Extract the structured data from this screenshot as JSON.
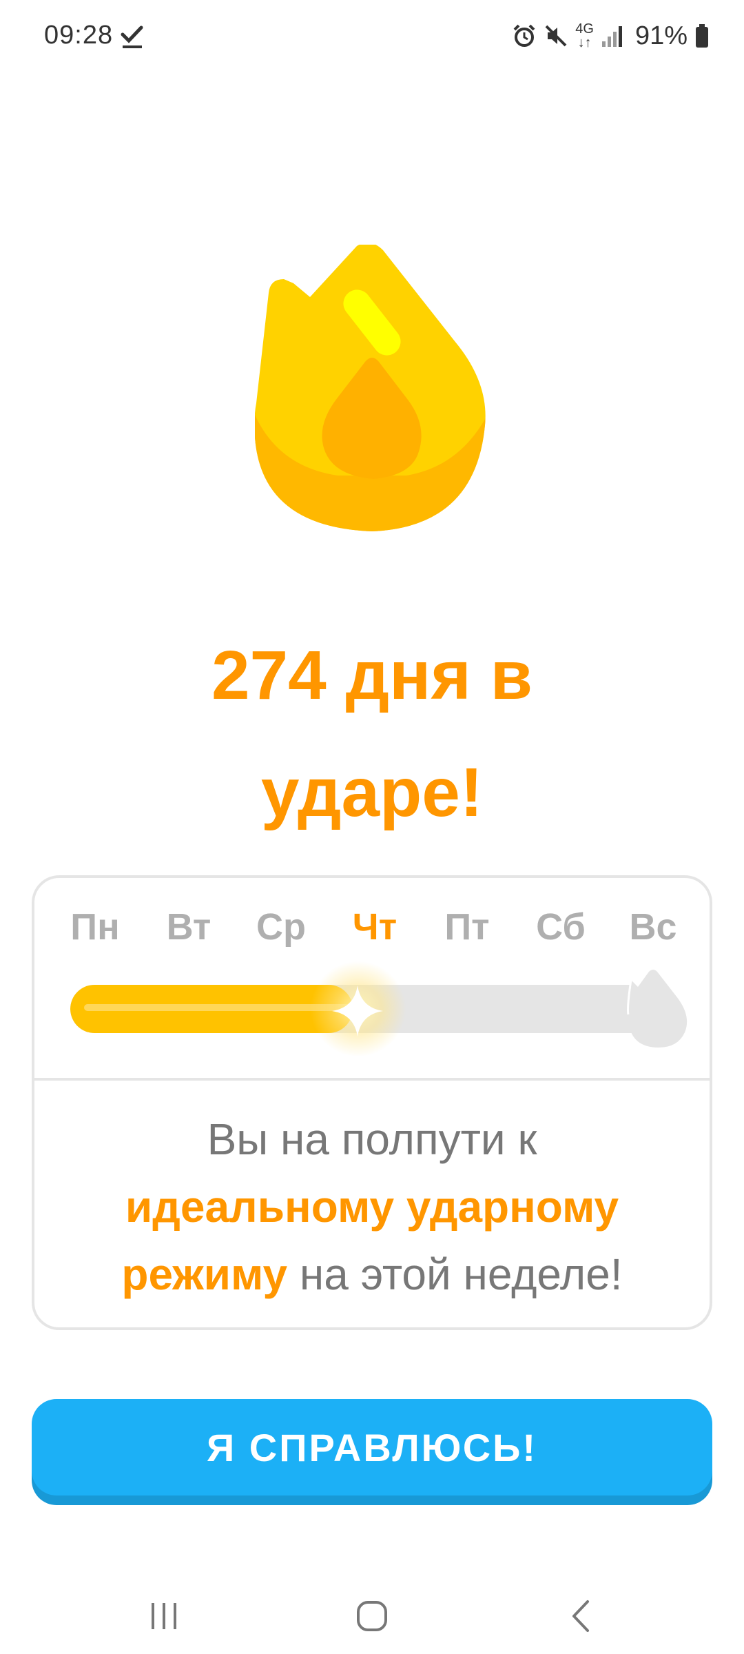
{
  "status_bar": {
    "time": "09:28",
    "network": "4G",
    "battery": "91%",
    "icons": [
      "check-icon",
      "alarm-icon",
      "mute-icon",
      "network-4g-icon",
      "signal-icon",
      "battery-icon"
    ]
  },
  "streak": {
    "title_line1": "274 дня в",
    "title_line2": "ударе!",
    "flame_icon": "flame-icon"
  },
  "week": {
    "days": [
      {
        "label": "Пн",
        "active": false
      },
      {
        "label": "Вт",
        "active": false
      },
      {
        "label": "Ср",
        "active": false
      },
      {
        "label": "Чт",
        "active": true
      },
      {
        "label": "Пт",
        "active": false
      },
      {
        "label": "Сб",
        "active": false
      },
      {
        "label": "Вс",
        "active": false
      }
    ],
    "progress_fraction": 0.5
  },
  "message": {
    "part1": "Вы на полпути к",
    "highlight_line1": "идеальному ударному",
    "highlight_line2": "режиму",
    "part2": " на этой неделе!"
  },
  "cta": {
    "label": "Я СПРАВЛЮСЬ!"
  },
  "colors": {
    "accent_orange": "#ff9600",
    "progress_yellow": "#ffc200",
    "button_blue": "#1cb0f6",
    "inactive_gray": "#afafaf"
  },
  "nav": {
    "icons": [
      "recent-apps-icon",
      "home-icon",
      "back-icon"
    ]
  }
}
